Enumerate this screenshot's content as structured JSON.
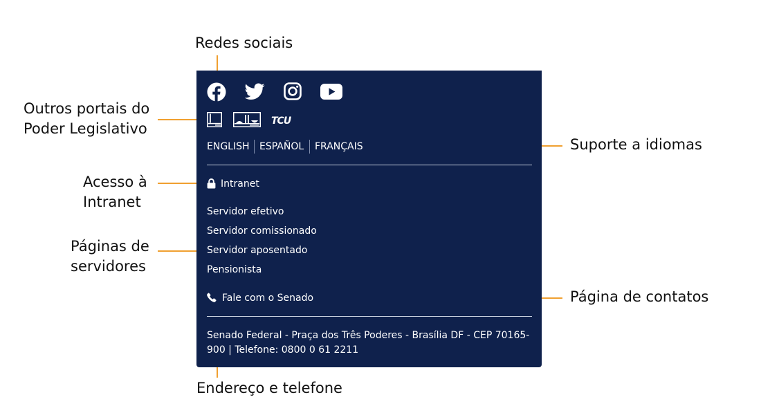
{
  "callouts": {
    "redes_sociais": "Redes sociais",
    "outros_portais_1": "Outros portais do",
    "outros_portais_2": "Poder Legislativo",
    "suporte_idiomas": "Suporte a idiomas",
    "acesso_1": "Acesso à",
    "acesso_2": "Intranet",
    "paginas_servidores_1": "Páginas de",
    "paginas_servidores_2": "servidores",
    "pagina_contatos": "Página de contatos",
    "endereco_telefone": "Endereço e telefone"
  },
  "footer": {
    "social_icons": [
      "facebook-icon",
      "twitter-icon",
      "instagram-icon",
      "youtube-icon"
    ],
    "portal_icons": [
      "camara-icon",
      "congresso-icon",
      "tcu-icon"
    ],
    "tcu_logo": "TCU",
    "languages": [
      "ENGLISH",
      "ESPAÑOL",
      "FRANÇAIS"
    ],
    "intranet": {
      "icon": "lock-icon",
      "label": "Intranet"
    },
    "servidores": [
      "Servidor efetivo",
      "Servidor comissionado",
      "Servidor aposentado",
      "Pensionista"
    ],
    "contato": {
      "icon": "phone-icon",
      "label": "Fale com o Senado"
    },
    "address": "Senado Federal - Praça dos Três Poderes - Brasília DF - CEP 70165-900 | Telefone: 0800 0 61 2211"
  },
  "colors": {
    "panel_background": "#0f214c",
    "callout_line": "#f0a030",
    "text_on_panel": "#ffffff"
  }
}
